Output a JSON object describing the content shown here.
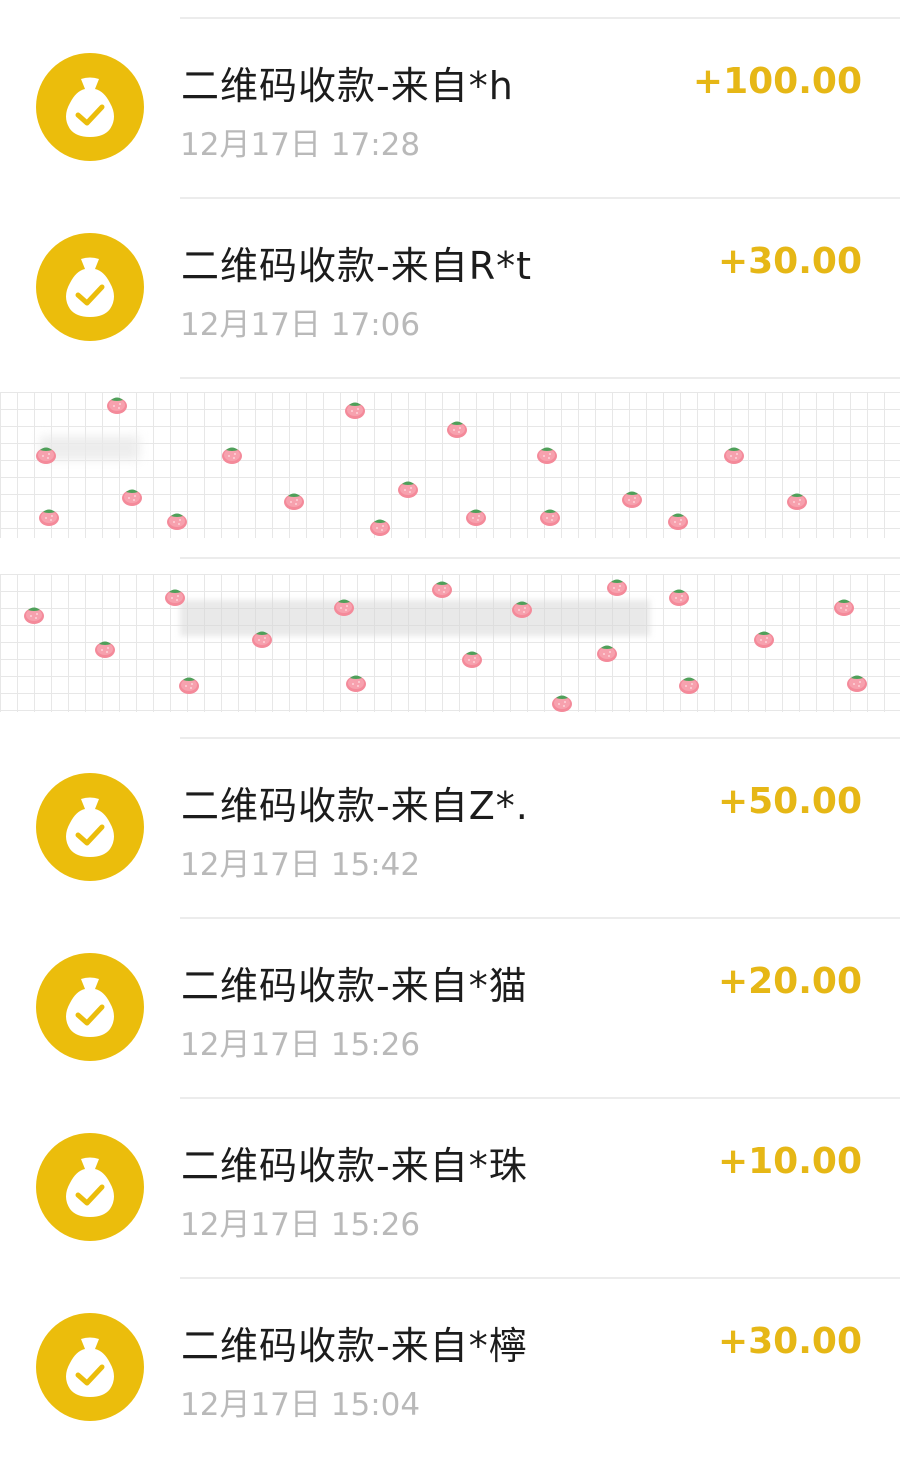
{
  "transactions": [
    {
      "title": "二维码收款-来自*h",
      "time": "12月17日 17:28",
      "amount": "+100.00"
    },
    {
      "title": "二维码收款-来自R*t",
      "time": "12月17日 17:06",
      "amount": "+30.00"
    },
    {
      "title": "二维码收款-来自Z*.",
      "time": "12月17日 15:42",
      "amount": "+50.00"
    },
    {
      "title": "二维码收款-来自*猫",
      "time": "12月17日 15:26",
      "amount": "+20.00"
    },
    {
      "title": "二维码收款-来自*珠",
      "time": "12月17日 15:26",
      "amount": "+10.00"
    },
    {
      "title": "二维码收款-来自*檸",
      "time": "12月17日 15:04",
      "amount": "+30.00"
    }
  ],
  "colors": {
    "icon_background": "#ebbd0c",
    "amount_text": "#e6b716",
    "title_text": "#1c1c1c",
    "time_text": "#b9b9b9"
  },
  "icons": {
    "transaction_icon": "money-bag-check-icon",
    "sticker_decoration": "strawberry-icon"
  }
}
